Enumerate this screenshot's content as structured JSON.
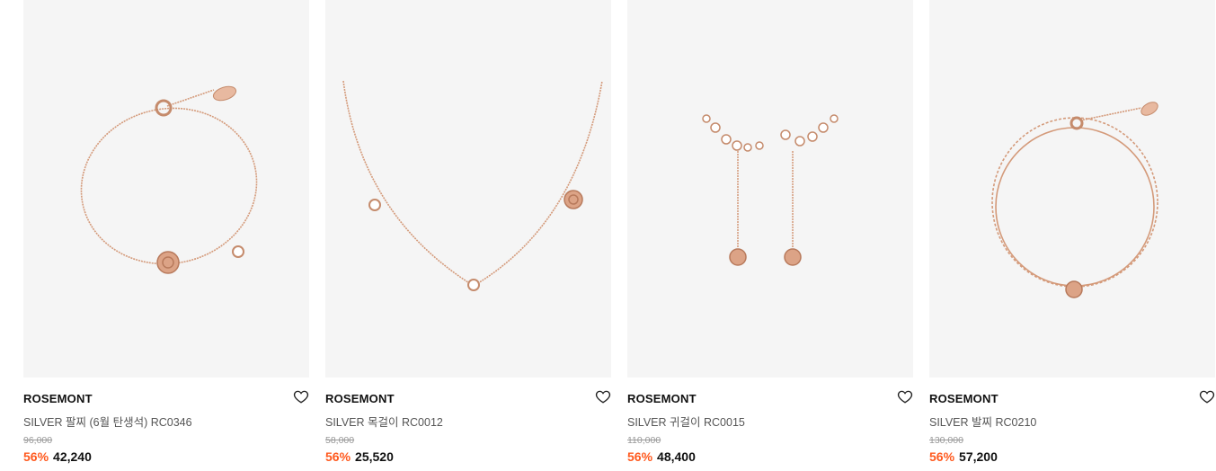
{
  "products": [
    {
      "brand": "ROSEMONT",
      "name": "SILVER 팔찌 (6월 탄생석) RC0346",
      "original_price": "96,000",
      "discount": "56%",
      "price": "42,240",
      "image_icon": "rose-gold-bracelet-image"
    },
    {
      "brand": "ROSEMONT",
      "name": "SILVER 목걸이 RC0012",
      "original_price": "58,000",
      "discount": "56%",
      "price": "25,520",
      "image_icon": "rose-gold-necklace-image"
    },
    {
      "brand": "ROSEMONT",
      "name": "SILVER 귀걸이 RC0015",
      "original_price": "110,000",
      "discount": "56%",
      "price": "48,400",
      "image_icon": "rose-gold-earrings-image"
    },
    {
      "brand": "ROSEMONT",
      "name": "SILVER 발찌 RC0210",
      "original_price": "130,000",
      "discount": "56%",
      "price": "57,200",
      "image_icon": "rose-gold-anklet-image"
    }
  ],
  "colors": {
    "discount": "#ff5a1f",
    "image_bg": "#f5f5f5",
    "rose_gold": "#d49a7a"
  }
}
